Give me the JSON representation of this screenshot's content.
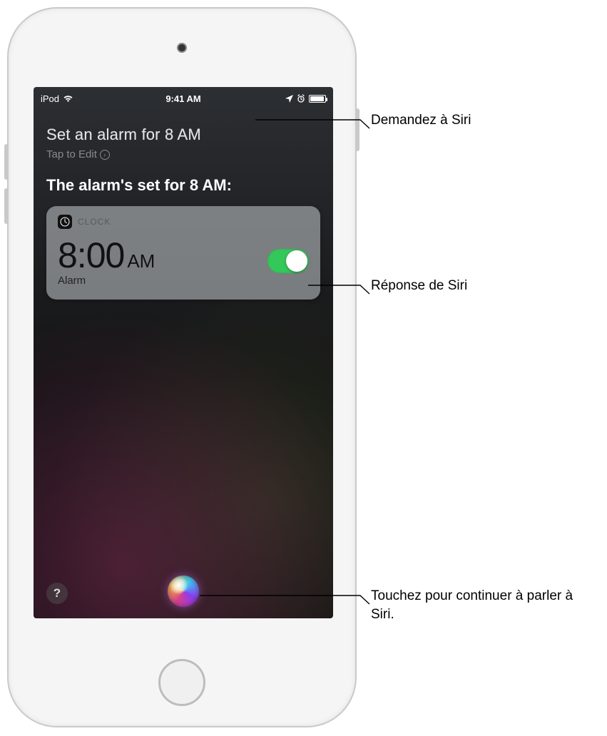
{
  "statusbar": {
    "device_name": "iPod",
    "wifi_icon": "wifi-icon",
    "time": "9:41 AM",
    "location_icon": "location-icon",
    "alarm_icon": "alarm-icon",
    "battery_level_pct": 95
  },
  "siri": {
    "user_query": "Set an alarm for 8 AM",
    "tap_to_edit_label": "Tap to Edit",
    "response_text": "The alarm's set for 8 AM:"
  },
  "clock_card": {
    "app_label": "CLOCK",
    "alarm_time": "8:00",
    "alarm_ampm": "AM",
    "alarm_label": "Alarm",
    "toggle_on": true
  },
  "bottom": {
    "help_label": "?"
  },
  "callouts": {
    "ask_siri": "Demandez à Siri",
    "siri_reply": "Réponse de Siri",
    "tap_continue": "Touchez pour continuer à parler à Siri."
  }
}
